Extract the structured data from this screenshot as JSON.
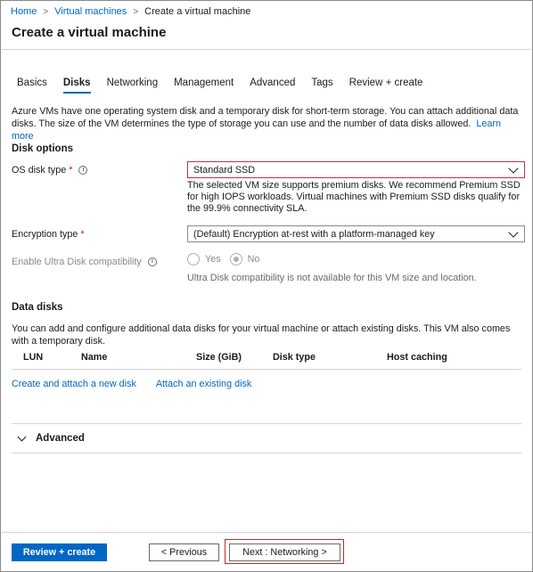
{
  "breadcrumb": {
    "home": "Home",
    "vms": "Virtual machines",
    "current": "Create a virtual machine"
  },
  "page_title": "Create a virtual machine",
  "tabs": [
    {
      "label": "Basics",
      "active": false
    },
    {
      "label": "Disks",
      "active": true
    },
    {
      "label": "Networking",
      "active": false
    },
    {
      "label": "Management",
      "active": false
    },
    {
      "label": "Advanced",
      "active": false
    },
    {
      "label": "Tags",
      "active": false
    },
    {
      "label": "Review + create",
      "active": false
    }
  ],
  "intro": {
    "text": "Azure VMs have one operating system disk and a temporary disk for short-term storage. You can attach additional data disks. The size of the VM determines the type of storage you can use and the number of data disks allowed.",
    "link": "Learn more"
  },
  "disk_options": {
    "heading": "Disk options",
    "os_disk_type": {
      "label": "OS disk type",
      "required_mark": "*",
      "value": "Standard SSD",
      "helper": "The selected VM size supports premium disks. We recommend Premium SSD for high IOPS workloads. Virtual machines with Premium SSD disks qualify for the 99.9% connectivity SLA."
    },
    "encryption_type": {
      "label": "Encryption type",
      "required_mark": "*",
      "value": "(Default) Encryption at-rest with a platform-managed key"
    },
    "ultra_disk": {
      "label": "Enable Ultra Disk compatibility",
      "options": [
        "Yes",
        "No"
      ],
      "selected": "No",
      "helper": "Ultra Disk compatibility is not available for this VM size and location."
    }
  },
  "data_disks": {
    "heading": "Data disks",
    "text": "You can add and configure additional data disks for your virtual machine or attach existing disks. This VM also comes with a temporary disk.",
    "columns": [
      "LUN",
      "Name",
      "Size (GiB)",
      "Disk type",
      "Host caching"
    ],
    "links": {
      "create": "Create and attach a new disk",
      "attach": "Attach an existing disk"
    }
  },
  "advanced_section": {
    "label": "Advanced"
  },
  "footer": {
    "review_create": "Review + create",
    "previous": "< Previous",
    "next": "Next : Networking >"
  },
  "colors": {
    "accent": "#0066c8",
    "highlight": "#d0261f",
    "required": "#c50f1f"
  }
}
